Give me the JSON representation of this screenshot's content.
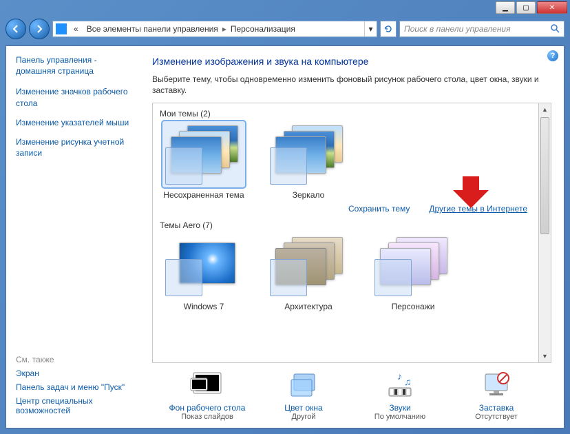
{
  "breadcrumb": {
    "prefix": "«",
    "item1": "Все элементы панели управления",
    "item2": "Персонализация"
  },
  "search": {
    "placeholder": "Поиск в панели управления"
  },
  "sidebar": {
    "home": "Панель управления - домашняя страница",
    "tasks": [
      "Изменение значков рабочего стола",
      "Изменение указателей мыши",
      "Изменение рисунка учетной записи"
    ],
    "seealso_h": "См. также",
    "seealso": [
      "Экран",
      "Панель задач и меню \"Пуск\"",
      "Центр специальных возможностей"
    ]
  },
  "content": {
    "heading": "Изменение изображения и звука на компьютере",
    "desc": "Выберите тему, чтобы одновременно изменить фоновый рисунок рабочего стола, цвет окна, звуки и заставку."
  },
  "sections": {
    "my_themes_h": "Мои темы (2)",
    "aero_h": "Темы Aero (7)"
  },
  "themes": {
    "my": [
      {
        "label": "Несохраненная тема"
      },
      {
        "label": "Зеркало"
      }
    ],
    "aero": [
      {
        "label": "Windows 7"
      },
      {
        "label": "Архитектура"
      },
      {
        "label": "Персонажи"
      }
    ]
  },
  "links": {
    "save": "Сохранить тему",
    "more": "Другие темы в Интернете"
  },
  "bottom": [
    {
      "label": "Фон рабочего стола",
      "sub": "Показ слайдов"
    },
    {
      "label": "Цвет окна",
      "sub": "Другой"
    },
    {
      "label": "Звуки",
      "sub": "По умолчанию"
    },
    {
      "label": "Заставка",
      "sub": "Отсутствует"
    }
  ]
}
